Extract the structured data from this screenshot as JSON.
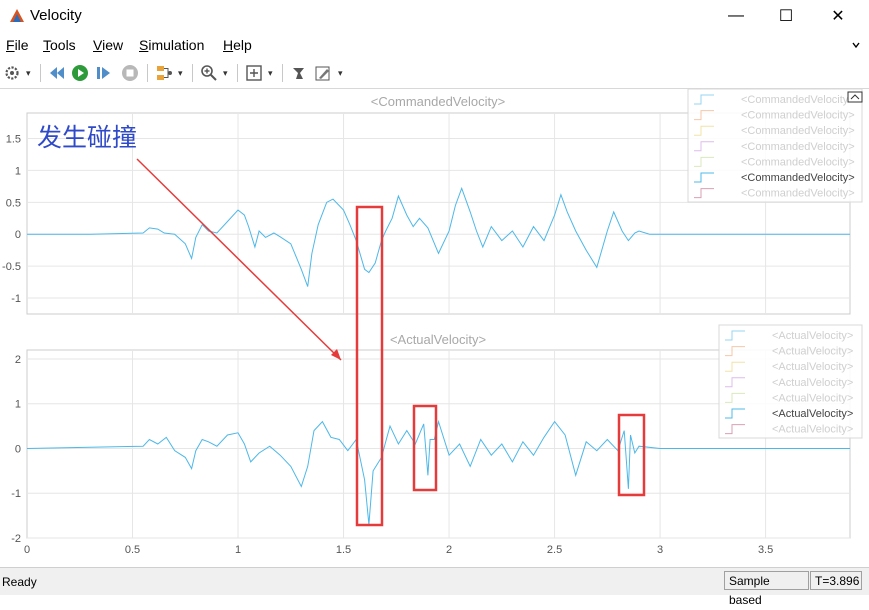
{
  "window": {
    "title": "Velocity",
    "minimize_glyph": "—",
    "maximize_glyph": "☐",
    "close_glyph": "✕",
    "icon": "matlab-icon"
  },
  "menu": [
    {
      "mnemonic": "F",
      "rest": "ile"
    },
    {
      "mnemonic": "T",
      "rest": "ools"
    },
    {
      "mnemonic": "V",
      "rest": "iew"
    },
    {
      "mnemonic": "S",
      "rest": "imulation",
      "prefix": ""
    },
    {
      "mnemonic": "H",
      "rest": "elp"
    }
  ],
  "toolbar_icons": [
    "gear-icon",
    "step-back-icon",
    "run-icon",
    "step-forward-icon",
    "stop-icon",
    "signal-select-icon",
    "zoom-in-icon",
    "fit-to-view-icon",
    "style-icon",
    "edit-icon"
  ],
  "annotation": {
    "text": "发生碰撞",
    "color": "#2f4ac9",
    "arrow_color": "#e53b3b"
  },
  "highlight_color": "#e53b3b",
  "signal_color": "#4db8e8",
  "status": {
    "left": "Ready",
    "mode": "Sample based",
    "time": "T=3.896"
  },
  "chart_data": [
    {
      "type": "line",
      "title": "<CommandedVelocity>",
      "yticks": [
        -1,
        -0.5,
        0,
        0.5,
        1,
        1.5
      ],
      "ytick_labels": [
        "-1",
        "-0.5",
        "0",
        "0.5",
        "1",
        "1.5"
      ],
      "ylim": [
        -1.25,
        1.9
      ],
      "xlim": [
        0,
        3.9
      ],
      "grid": true,
      "legend_position": "top-right",
      "legend_entries": [
        {
          "label": "<CommandedVelocity>",
          "color": "#4db8e8",
          "active": false
        },
        {
          "label": "<CommandedVelocity>",
          "color": "#f0a070",
          "active": false
        },
        {
          "label": "<CommandedVelocity>",
          "color": "#e8d070",
          "active": false
        },
        {
          "label": "<CommandedVelocity>",
          "color": "#c890e0",
          "active": false
        },
        {
          "label": "<CommandedVelocity>",
          "color": "#c0d890",
          "active": false
        },
        {
          "label": "<CommandedVelocity>",
          "color": "#4db8e8",
          "active": true
        },
        {
          "label": "<CommandedVelocity>",
          "color": "#c06080",
          "active": false
        }
      ],
      "series": [
        {
          "name": "<CommandedVelocity>",
          "x": [
            0,
            0.3,
            0.55,
            0.58,
            0.62,
            0.65,
            0.7,
            0.75,
            0.78,
            0.8,
            0.83,
            0.86,
            0.9,
            0.95,
            1.0,
            1.03,
            1.05,
            1.08,
            1.1,
            1.13,
            1.17,
            1.2,
            1.25,
            1.3,
            1.33,
            1.35,
            1.38,
            1.42,
            1.45,
            1.5,
            1.53,
            1.56,
            1.6,
            1.62,
            1.65,
            1.68,
            1.7,
            1.73,
            1.76,
            1.8,
            1.83,
            1.86,
            1.9,
            1.95,
            2.0,
            2.03,
            2.06,
            2.1,
            2.13,
            2.16,
            2.2,
            2.25,
            2.3,
            2.35,
            2.4,
            2.45,
            2.5,
            2.53,
            2.56,
            2.6,
            2.65,
            2.7,
            2.75,
            2.78,
            2.82,
            2.85,
            2.88,
            2.9,
            2.95,
            3.0,
            3.5,
            3.9
          ],
          "y": [
            0,
            0,
            0.02,
            0.1,
            0.08,
            0.02,
            0.0,
            -0.15,
            -0.38,
            -0.05,
            0.15,
            0.05,
            0.02,
            0.2,
            0.38,
            0.3,
            0.12,
            -0.2,
            0.05,
            -0.05,
            0.02,
            -0.04,
            -0.15,
            -0.55,
            -0.82,
            -0.3,
            0.15,
            0.5,
            0.55,
            0.38,
            0.15,
            -0.1,
            -0.55,
            -0.6,
            -0.45,
            -0.1,
            0.05,
            0.25,
            0.6,
            0.3,
            0.12,
            0.25,
            0.1,
            -0.3,
            0.05,
            0.45,
            0.72,
            0.35,
            0.05,
            -0.2,
            0.12,
            -0.1,
            0.05,
            -0.2,
            0.12,
            -0.1,
            0.3,
            0.62,
            0.35,
            0.05,
            -0.25,
            -0.52,
            0.05,
            0.35,
            0.05,
            -0.1,
            0.02,
            0.05,
            0.0,
            0,
            0,
            0
          ]
        }
      ]
    },
    {
      "type": "line",
      "title": "<ActualVelocity>",
      "yticks": [
        -2,
        -1,
        0,
        1,
        2
      ],
      "ytick_labels": [
        "-2",
        "-1",
        "0",
        "1",
        "2"
      ],
      "xticks": [
        0,
        0.5,
        1,
        1.5,
        2,
        2.5,
        3,
        3.5
      ],
      "xtick_labels": [
        "0",
        "0.5",
        "1",
        "1.5",
        "2",
        "2.5",
        "3",
        "3.5"
      ],
      "ylim": [
        -2.0,
        2.2
      ],
      "xlim": [
        0,
        3.9
      ],
      "grid": true,
      "legend_position": "top-right",
      "legend_entries": [
        {
          "label": "<ActualVelocity>",
          "color": "#4db8e8",
          "active": false
        },
        {
          "label": "<ActualVelocity>",
          "color": "#f0a070",
          "active": false
        },
        {
          "label": "<ActualVelocity>",
          "color": "#e8d070",
          "active": false
        },
        {
          "label": "<ActualVelocity>",
          "color": "#c890e0",
          "active": false
        },
        {
          "label": "<ActualVelocity>",
          "color": "#c0d890",
          "active": false
        },
        {
          "label": "<ActualVelocity>",
          "color": "#4db8e8",
          "active": true
        },
        {
          "label": "<ActualVelocity>",
          "color": "#c06080",
          "active": false
        }
      ],
      "series": [
        {
          "name": "<ActualVelocity>",
          "x": [
            0,
            0.55,
            0.58,
            0.62,
            0.66,
            0.7,
            0.75,
            0.78,
            0.8,
            0.83,
            0.86,
            0.9,
            0.95,
            1.0,
            1.03,
            1.06,
            1.1,
            1.15,
            1.2,
            1.25,
            1.3,
            1.33,
            1.36,
            1.4,
            1.44,
            1.48,
            1.52,
            1.56,
            1.6,
            1.62,
            1.64,
            1.66,
            1.68,
            1.7,
            1.72,
            1.76,
            1.8,
            1.84,
            1.88,
            1.9,
            1.91,
            1.93,
            1.95,
            2.0,
            2.05,
            2.1,
            2.15,
            2.2,
            2.25,
            2.3,
            2.35,
            2.4,
            2.45,
            2.5,
            2.55,
            2.6,
            2.65,
            2.7,
            2.75,
            2.8,
            2.83,
            2.85,
            2.86,
            2.88,
            2.9,
            3.0,
            3.5,
            3.9
          ],
          "y": [
            0,
            0.05,
            0.2,
            0.1,
            0.25,
            -0.05,
            -0.2,
            -0.45,
            -0.05,
            0.2,
            0.15,
            0.05,
            0.3,
            0.35,
            0.1,
            -0.3,
            -0.1,
            0.05,
            -0.15,
            -0.4,
            -0.85,
            -0.4,
            0.4,
            0.6,
            0.25,
            0.2,
            -0.05,
            0.2,
            -0.7,
            -1.7,
            -0.5,
            -0.35,
            -0.2,
            0.15,
            0.5,
            0.1,
            0.4,
            0.1,
            0.55,
            -0.6,
            0.2,
            0.2,
            0.6,
            -0.15,
            0.1,
            -0.4,
            0.2,
            -0.15,
            0.1,
            -0.3,
            0.15,
            -0.15,
            0.25,
            0.6,
            0.3,
            -0.6,
            0.15,
            -0.05,
            0.2,
            -0.05,
            0.4,
            -0.9,
            0.3,
            -0.1,
            0.05,
            0,
            0,
            0
          ]
        }
      ]
    }
  ]
}
